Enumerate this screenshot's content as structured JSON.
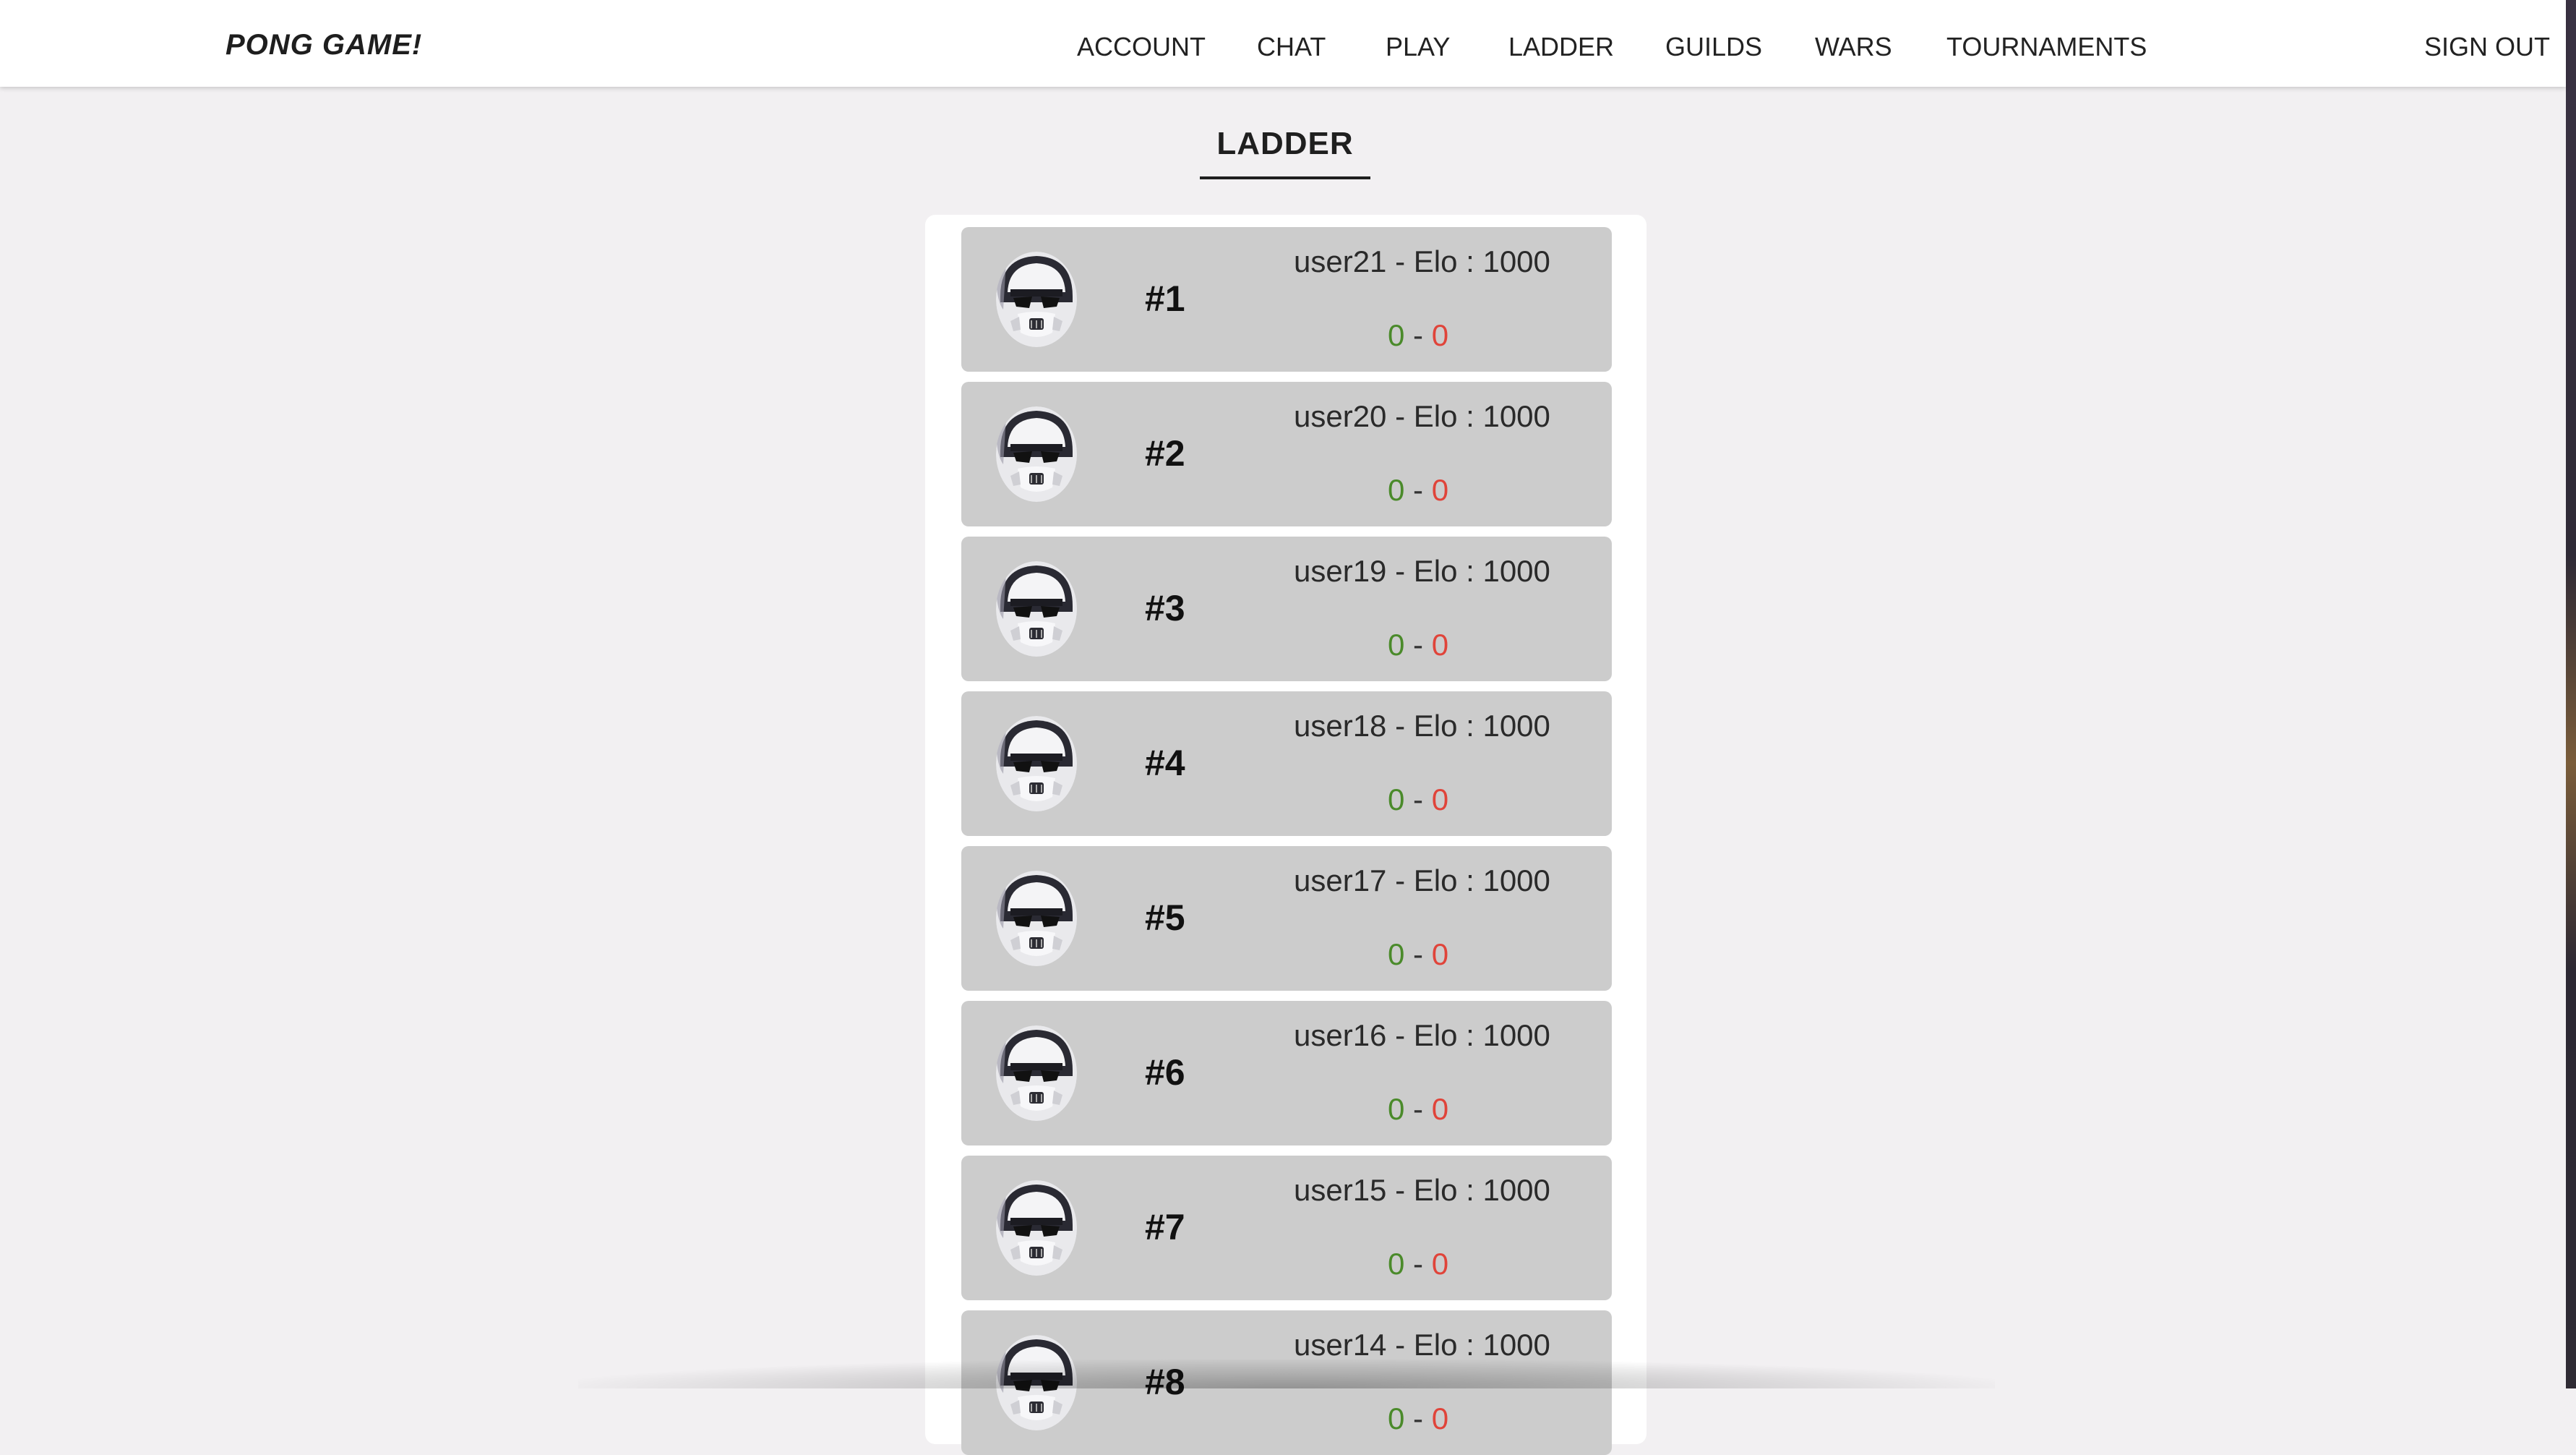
{
  "header": {
    "brand": "PONG GAME!",
    "nav": [
      "ACCOUNT",
      "CHAT",
      "PLAY",
      "LADDER",
      "GUILDS",
      "WARS",
      "TOURNAMENTS"
    ],
    "sign_out": "SIGN OUT"
  },
  "page": {
    "title": "LADDER"
  },
  "ladder": [
    {
      "rank": "#1",
      "info": "user21 - Elo : 1000",
      "wins": "0",
      "sep": "-",
      "losses": "0"
    },
    {
      "rank": "#2",
      "info": "user20 - Elo : 1000",
      "wins": "0",
      "sep": "-",
      "losses": "0"
    },
    {
      "rank": "#3",
      "info": "user19 - Elo : 1000",
      "wins": "0",
      "sep": "-",
      "losses": "0"
    },
    {
      "rank": "#4",
      "info": "user18 - Elo : 1000",
      "wins": "0",
      "sep": "-",
      "losses": "0"
    },
    {
      "rank": "#5",
      "info": "user17 - Elo : 1000",
      "wins": "0",
      "sep": "-",
      "losses": "0"
    },
    {
      "rank": "#6",
      "info": "user16 - Elo : 1000",
      "wins": "0",
      "sep": "-",
      "losses": "0"
    },
    {
      "rank": "#7",
      "info": "user15 - Elo : 1000",
      "wins": "0",
      "sep": "-",
      "losses": "0"
    },
    {
      "rank": "#8",
      "info": "user14 - Elo : 1000",
      "wins": "0",
      "sep": "-",
      "losses": "0"
    }
  ],
  "colors": {
    "wins": "#4a8a2a",
    "losses": "#e0443a",
    "row_bg": "#cccccc",
    "page_bg": "#f2f0f2"
  },
  "icons": {
    "avatar": "stormtrooper-avatar-icon"
  }
}
